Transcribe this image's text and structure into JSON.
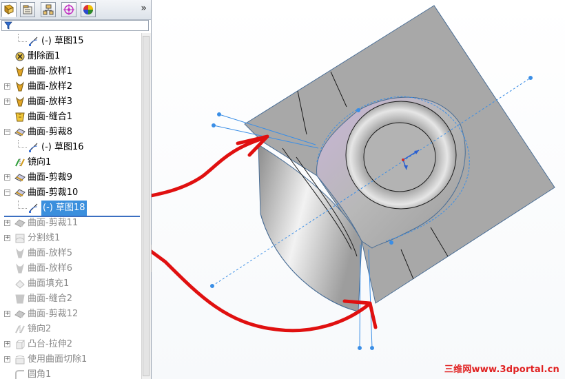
{
  "tabs": [
    {
      "name": "feature-manager",
      "icon": "feature-tree-icon"
    },
    {
      "name": "property-manager",
      "icon": "property-icon"
    },
    {
      "name": "configuration-manager",
      "icon": "configuration-icon"
    },
    {
      "name": "dimxpert-manager",
      "icon": "target-icon"
    },
    {
      "name": "display-manager",
      "icon": "appearance-icon"
    }
  ],
  "overflow_glyph": "»",
  "tree": [
    {
      "label": "(-) 草图15",
      "icon": "sketch-icon",
      "state": "active"
    },
    {
      "label": "删除面1",
      "icon": "delete-face-icon",
      "state": "active"
    },
    {
      "label": "曲面-放样1",
      "icon": "surface-loft-icon",
      "state": "active"
    },
    {
      "label": "曲面-放样2",
      "icon": "surface-loft-icon",
      "state": "active"
    },
    {
      "label": "曲面-放样3",
      "icon": "surface-loft-icon",
      "state": "active"
    },
    {
      "label": "曲面-缝合1",
      "icon": "surface-knit-icon",
      "state": "active"
    },
    {
      "label": "曲面-剪裁8",
      "icon": "surface-trim-icon",
      "state": "active"
    },
    {
      "label": "(-) 草图16",
      "icon": "sketch-icon",
      "state": "active"
    },
    {
      "label": "镜向1",
      "icon": "mirror-icon",
      "state": "active"
    },
    {
      "label": "曲面-剪裁9",
      "icon": "surface-trim-icon",
      "state": "active"
    },
    {
      "label": "曲面-剪裁10",
      "icon": "surface-trim-icon",
      "state": "active"
    },
    {
      "label": "(-) 草图18",
      "icon": "sketch-icon",
      "state": "selected"
    },
    {
      "label": "曲面-剪裁11",
      "icon": "surface-trim-icon",
      "state": "suppressed"
    },
    {
      "label": "分割线1",
      "icon": "split-line-icon",
      "state": "suppressed"
    },
    {
      "label": "曲面-放样5",
      "icon": "surface-loft-icon",
      "state": "suppressed"
    },
    {
      "label": "曲面-放样6",
      "icon": "surface-loft-icon",
      "state": "suppressed"
    },
    {
      "label": "曲面填充1",
      "icon": "surface-fill-icon",
      "state": "suppressed"
    },
    {
      "label": "曲面-缝合2",
      "icon": "surface-knit-icon",
      "state": "suppressed"
    },
    {
      "label": "曲面-剪裁12",
      "icon": "surface-trim-icon",
      "state": "suppressed"
    },
    {
      "label": "镜向2",
      "icon": "mirror-icon",
      "state": "suppressed"
    },
    {
      "label": "凸台-拉伸2",
      "icon": "boss-extrude-icon",
      "state": "suppressed"
    },
    {
      "label": "使用曲面切除1",
      "icon": "surface-cut-icon",
      "state": "suppressed"
    },
    {
      "label": "圆角1",
      "icon": "fillet-icon",
      "state": "suppressed"
    }
  ],
  "watermark": "三维网www.3dportal.cn",
  "colors": {
    "selection": "#3b8fdd",
    "annotation": "#e01010",
    "sketch": "#3a8ee6",
    "surface": "#a9a9a9"
  }
}
